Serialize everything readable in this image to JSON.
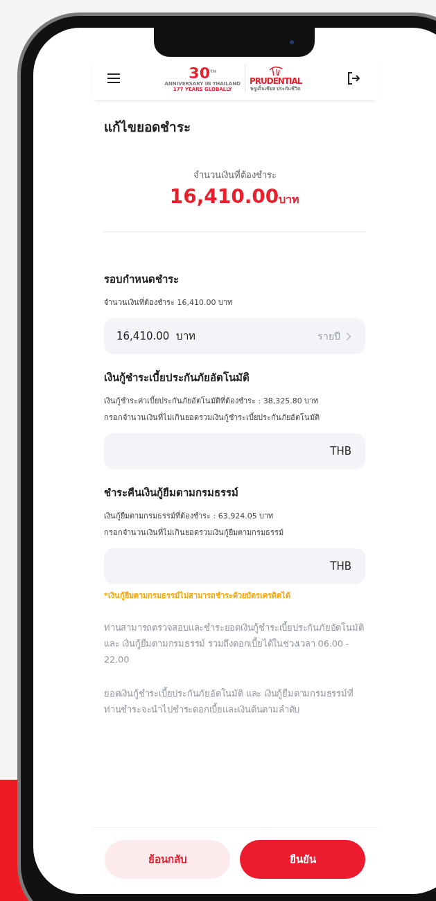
{
  "logo": {
    "anniversary_number": "30",
    "anniversary_suffix": "TH",
    "anniversary_text": "ANNIVERSARY IN THAILAND",
    "years_text": "177 YEARS GLOBALLY",
    "brand": "PRUDENTIAL",
    "brand_thai": "พรูเด็นเชียล ประกันชีวิต"
  },
  "page_title": "แก้ไขยอดชำระ",
  "total": {
    "label": "จำนวนเงินที่ต้องชำระ",
    "amount": "16,410.00",
    "unit": "บาท"
  },
  "sections": [
    {
      "kind": "period",
      "title": "รอบกำหนดชำระ",
      "notes": [
        "จำนวนเงินที่ต้องชำระ 16,410.00 บาท"
      ],
      "value": "16,410.00",
      "unit": "บาท",
      "period": "รายปี"
    },
    {
      "kind": "input",
      "title": "เงินกู้ชำระเบี้ยประกันภัยอัตโนมัติ",
      "notes": [
        "เงินกู้ชำระค่าเบี้ยประกันภัยอัตโนมัติที่ต้องชำระ : 38,325.80 บาท",
        "กรอกจำนวนเงินที่ไม่เกินยอดรวมเงินกู้ชำระเบี้ยประกันภัยอัตโนมัติ"
      ],
      "unit": "THB"
    },
    {
      "kind": "input",
      "title": "ชำระคืนเงินกู้ยืมตามกรมธรรม์",
      "notes": [
        "เงินกู้ยืมตามกรมธรรม์ที่ต้องชำระ : 63,924.05 บาท",
        "กรอกจำนวนเงินที่ไม่เกินยอดรวมเงินกู้ยืมตามกรมธรรม์"
      ],
      "unit": "THB"
    }
  ],
  "warning": "*เงินกู้ยืมตามกรมธรรม์ไม่สามารถชำระด้วยบัตรเครดิตได้",
  "paragraphs": [
    "ท่านสามารถตรวจสอบและชำระยอดเงินกู้ชำระเบี้ยประกันภัยอัตโนมัติ และ เงินกู้ยืมตามกรมธรรม์ รวมถึงดอกเบี้ยได้ในช่วงเวลา 06.00 - 22.00",
    "ยอดเงินกู้ชำระเบี้ยประกันภัยอัตโนมัติ และ เงินกู้ยืมตามกรมธรรม์ที่ท่านชำระจะนำไปชำระดอกเบี้ยและเงินต้นตามลำดับ"
  ],
  "buttons": [
    {
      "label": "ย้อนกลับ",
      "kind": "secondary"
    },
    {
      "label": "ยืนยัน",
      "kind": "primary"
    }
  ]
}
